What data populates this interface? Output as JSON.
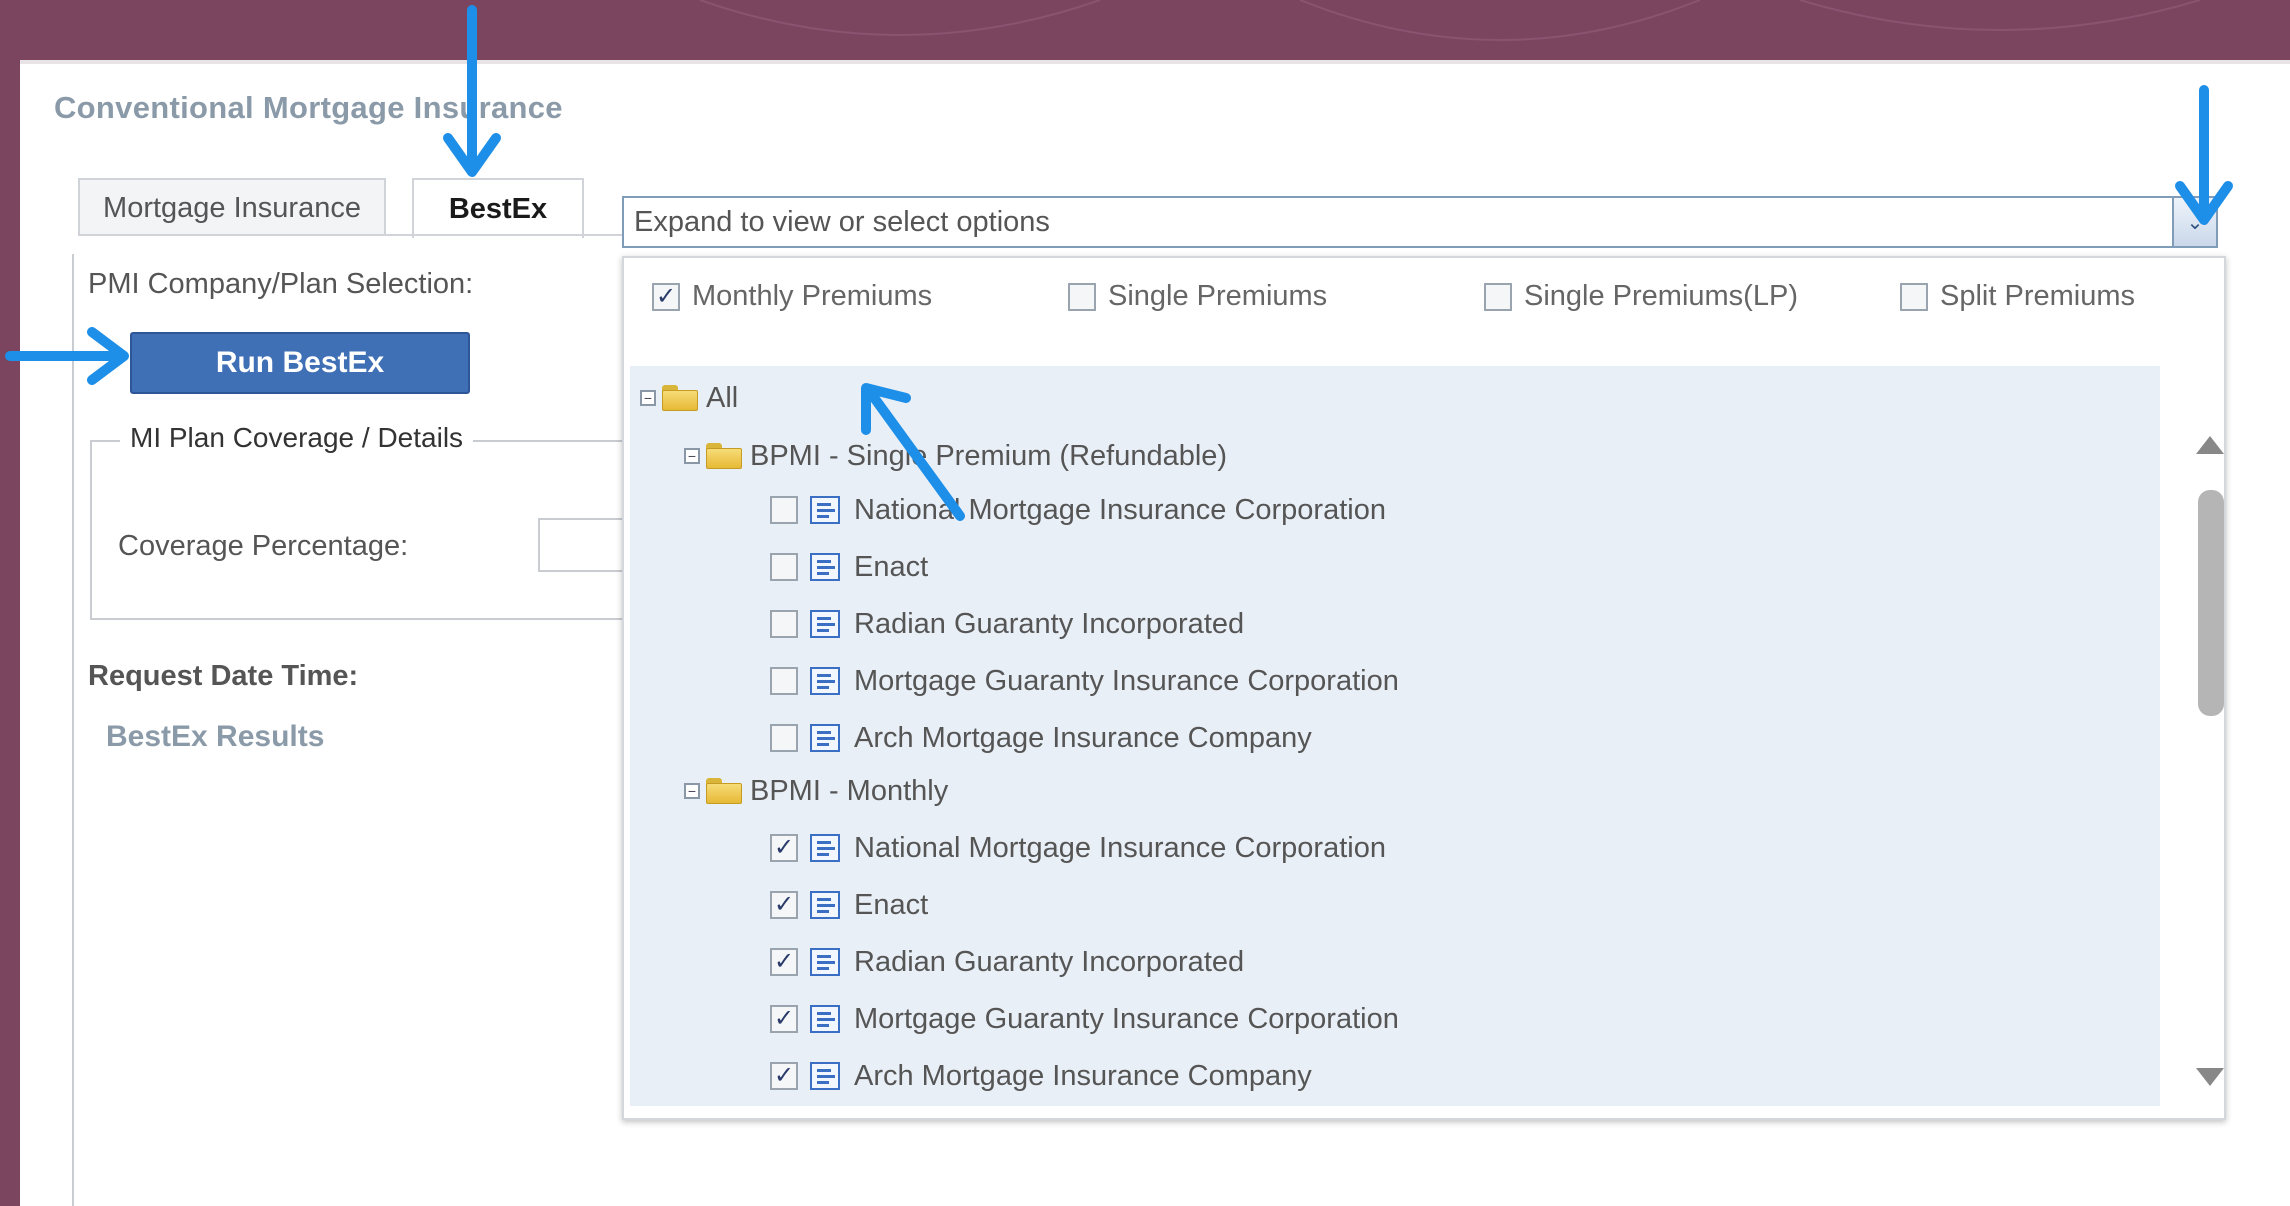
{
  "section_title": "Conventional Mortgage Insurance",
  "tabs": [
    {
      "label": "Mortgage Insurance"
    },
    {
      "label": "BestEx"
    }
  ],
  "pmi_label": "PMI Company/Plan Selection:",
  "select": {
    "placeholder": "Expand to view or select options"
  },
  "run_button": "Run BestEx",
  "coverage_legend": "MI Plan Coverage / Details",
  "coverage_label": "Coverage Percentage:",
  "request_label": "Request Date Time:",
  "results_label": "BestEx Results",
  "filters": [
    {
      "label": "Monthly Premiums",
      "checked": true
    },
    {
      "label": "Single Premiums",
      "checked": false
    },
    {
      "label": "Single Premiums(LP)",
      "checked": false
    },
    {
      "label": "Split Premiums",
      "checked": false
    }
  ],
  "tree": {
    "root": "All",
    "groups": [
      {
        "label": "BPMI - Single Premium (Refundable)",
        "items": [
          {
            "label": "National Mortgage Insurance Corporation",
            "checked": false
          },
          {
            "label": "Enact",
            "checked": false
          },
          {
            "label": "Radian Guaranty Incorporated",
            "checked": false
          },
          {
            "label": "Mortgage Guaranty Insurance Corporation",
            "checked": false
          },
          {
            "label": "Arch Mortgage Insurance Company",
            "checked": false
          }
        ]
      },
      {
        "label": "BPMI - Monthly",
        "items": [
          {
            "label": "National Mortgage Insurance Corporation",
            "checked": true
          },
          {
            "label": "Enact",
            "checked": true
          },
          {
            "label": "Radian Guaranty Incorporated",
            "checked": true
          },
          {
            "label": "Mortgage Guaranty Insurance Corporation",
            "checked": true
          },
          {
            "label": "Arch Mortgage Insurance Company",
            "checked": true
          }
        ]
      }
    ]
  },
  "colors": {
    "accent": "#3f6fb5",
    "annotation_arrow": "#1e8fe8",
    "background": "#7b4560"
  }
}
